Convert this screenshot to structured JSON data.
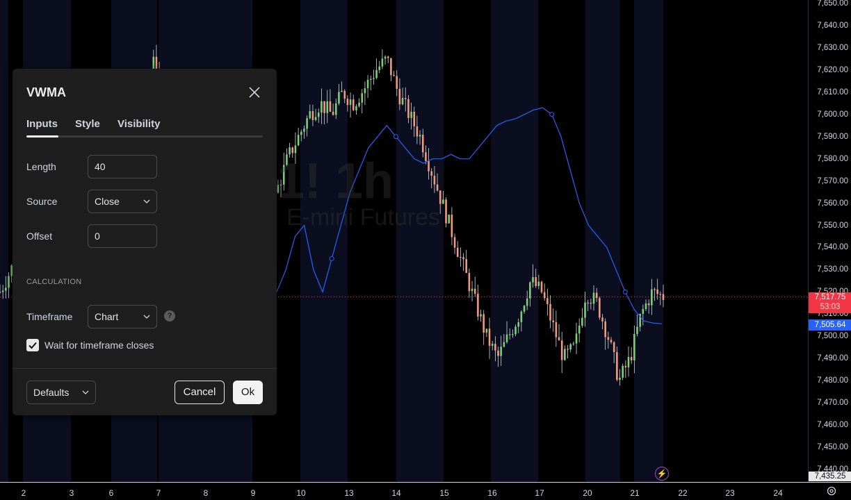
{
  "watermark": {
    "symbol": "1! 1h",
    "name": "E-mini Futures"
  },
  "price_scale": {
    "ticks": [
      "7,650.00",
      "7,640.00",
      "7,630.00",
      "7,620.00",
      "7,610.00",
      "7,600.00",
      "7,590.00",
      "7,580.00",
      "7,570.00",
      "7,560.00",
      "7,550.00",
      "7,540.00",
      "7,530.00",
      "7,520.00",
      "7,510.00",
      "7,500.00",
      "7,490.00",
      "7,480.00",
      "7,470.00",
      "7,460.00",
      "7,450.00",
      "7,440.00"
    ],
    "last_price": "7,517.75",
    "countdown": "53:03",
    "vwma_value": "7,505.64",
    "crosshair_price": "7,435.25",
    "last_price_color": "#f23645",
    "vwma_color": "#2962ff"
  },
  "time_axis": {
    "labels": [
      "2",
      "3",
      "6",
      "7",
      "8",
      "9",
      "10",
      "13",
      "14",
      "15",
      "16",
      "17",
      "20",
      "21",
      "22",
      "23",
      "24"
    ]
  },
  "chart_data": {
    "type": "candlestick",
    "title": "E-mini Futures",
    "interval": "1h",
    "ylim": [
      7435,
      7652
    ],
    "x_labels": [
      "2",
      "3",
      "6",
      "7",
      "8",
      "9",
      "10",
      "13",
      "14",
      "15",
      "16",
      "17",
      "20",
      "21",
      "22",
      "23",
      "24"
    ],
    "last_price": 7517.75,
    "series": [
      {
        "name": "Price",
        "trend": [
          7520,
          7530,
          7545,
          7550,
          7525,
          7520,
          7535,
          7560,
          7585,
          7590,
          7580,
          7575,
          7590,
          7605,
          7625,
          7600,
          7595,
          7575,
          7590,
          7600,
          7585,
          7560,
          7550,
          7540,
          7545,
          7565,
          7580,
          7590,
          7600,
          7605,
          7600,
          7610,
          7605,
          7612,
          7620,
          7625,
          7610,
          7600,
          7590,
          7575,
          7560,
          7545,
          7530,
          7515,
          7500,
          7490,
          7500,
          7510,
          7525,
          7520,
          7505,
          7490,
          7495,
          7520,
          7515,
          7500,
          7480,
          7490,
          7510,
          7520,
          7518
        ]
      },
      {
        "name": "VWMA",
        "color": "#2962ff",
        "values": [
          7520,
          7530,
          7545,
          7550,
          7530,
          7520,
          7535,
          7550,
          7565,
          7575,
          7585,
          7590,
          7595,
          7590,
          7585,
          7580,
          7578,
          7580,
          7580,
          7582,
          7580,
          7580,
          7585,
          7590,
          7595,
          7597,
          7598,
          7600,
          7602,
          7603,
          7600,
          7590,
          7575,
          7560,
          7550,
          7545,
          7540,
          7530,
          7520,
          7512,
          7507,
          7506,
          7505.64
        ]
      }
    ]
  },
  "dialog": {
    "title": "VWMA",
    "tabs": [
      "Inputs",
      "Style",
      "Visibility"
    ],
    "length_label": "Length",
    "length_value": "40",
    "source_label": "Source",
    "source_value": "Close",
    "offset_label": "Offset",
    "offset_value": "0",
    "section_calculation": "CALCULATION",
    "timeframe_label": "Timeframe",
    "timeframe_value": "Chart",
    "help_glyph": "?",
    "wait_label": "Wait for timeframe closes",
    "wait_checked": true,
    "defaults_label": "Defaults",
    "cancel_label": "Cancel",
    "ok_label": "Ok"
  }
}
